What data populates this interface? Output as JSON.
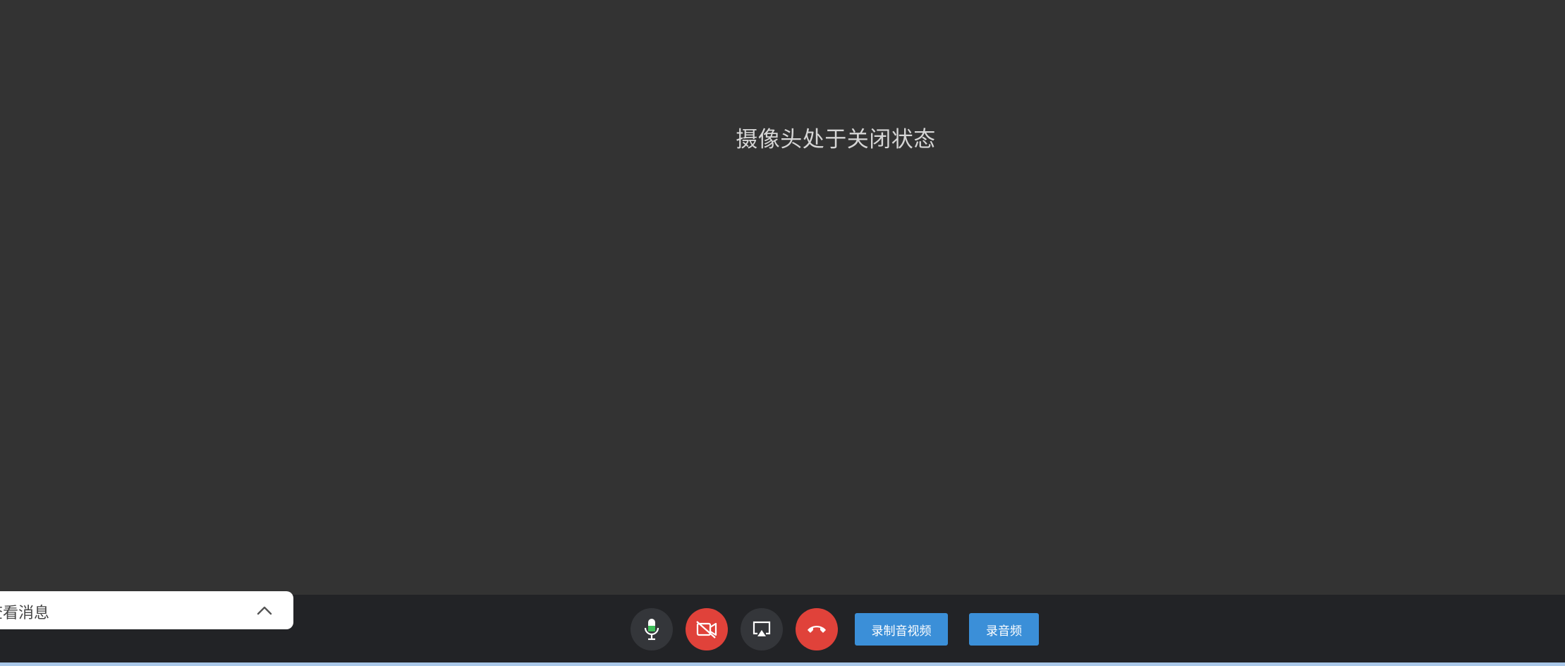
{
  "video": {
    "camera_status": "摄像头处于关闭状态"
  },
  "messages": {
    "title": "查看消息",
    "toggle_icon": "chevron-up-icon"
  },
  "controls": {
    "mic_icon": "microphone-icon",
    "camera_icon": "camera-off-icon",
    "screen_share_icon": "screen-share-icon",
    "hangup_icon": "phone-hangup-icon",
    "record_av_label": "录制音视频",
    "record_audio_label": "录音频"
  },
  "colors": {
    "stage_background": "#333333",
    "toolbar_background": "#222326",
    "danger": "#e0423a",
    "primary": "#3b8fd8"
  }
}
